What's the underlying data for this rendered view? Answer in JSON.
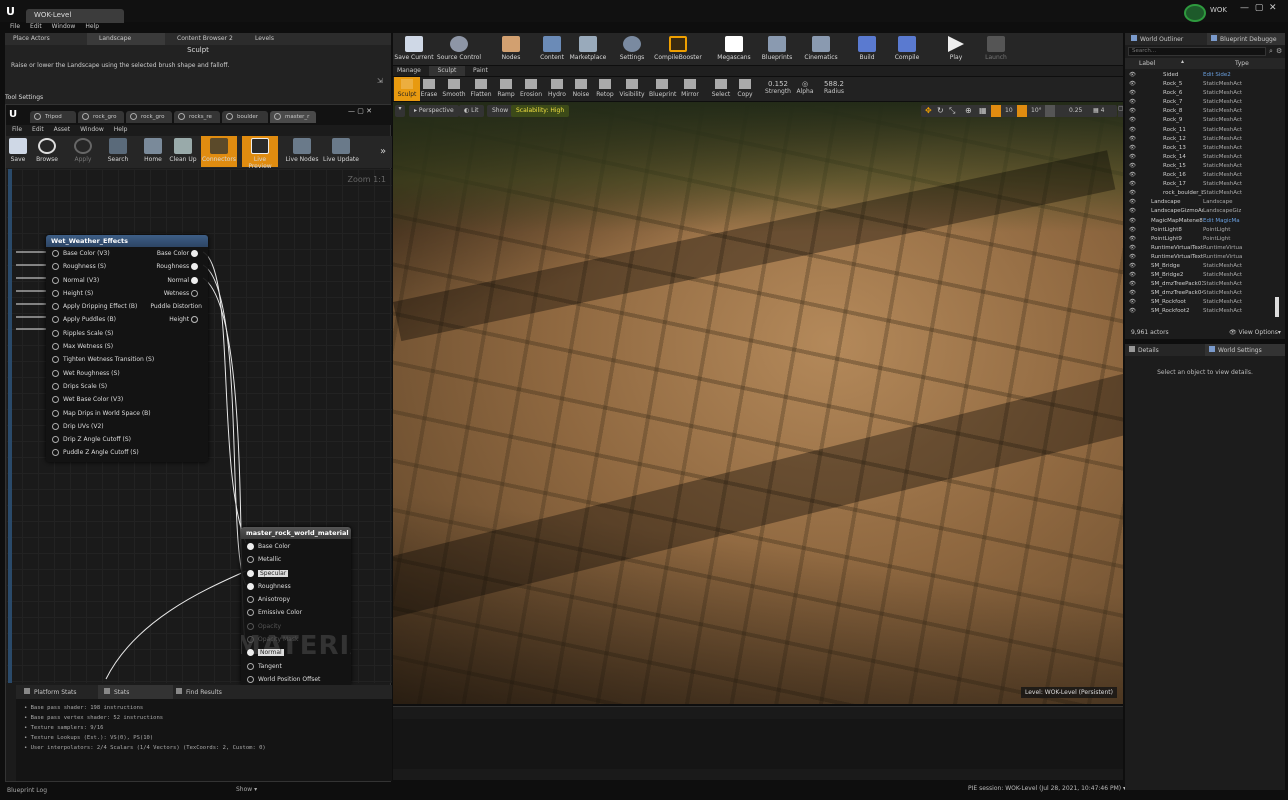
{
  "window": {
    "tab": "WOK-Level",
    "brand": "WOK",
    "menu": [
      "File",
      "Edit",
      "Window",
      "Help"
    ]
  },
  "modes": {
    "place": "Place Actors",
    "landscape": "Landscape",
    "content": "Content Browser 2",
    "levels": "Levels",
    "sculpt_title": "Sculpt",
    "sculpt_desc": "Raise or lower the Landscape using the selected brush shape and falloff.",
    "tool_settings": "Tool Settings"
  },
  "mat": {
    "tabs": [
      "Tripod",
      "rock_gro",
      "rock_gro",
      "rocks_re",
      "boulder",
      "master_r"
    ],
    "menu": [
      "File",
      "Edit",
      "Asset",
      "Window",
      "Help"
    ],
    "toolbar": [
      "Save",
      "Browse",
      "Apply",
      "Search",
      "Home",
      "Clean Up",
      "Connectors",
      "Live Preview",
      "Live Nodes",
      "Live Update"
    ],
    "zoom": "Zoom 1:1"
  },
  "node1": {
    "title": "Wet_Weather_Effects",
    "inputs": [
      "Base Color (V3)",
      "Roughness (S)",
      "Normal (V3)",
      "Height (S)",
      "Apply Dripping Effect (B)",
      "Apply Puddles (B)",
      "Ripples Scale (S)",
      "Max Wetness (S)",
      "Tighten Wetness Transition (S)",
      "Wet Roughness (S)",
      "Drips Scale (S)",
      "Wet Base Color (V3)",
      "Map Drips in World Space (B)",
      "Drip UVs (V2)",
      "Drip Z Angle Cutoff (S)",
      "Puddle Z Angle Cutoff (S)"
    ],
    "outputs": [
      "Base Color",
      "Roughness",
      "Normal",
      "Wetness",
      "Puddle Distortion",
      "Height"
    ]
  },
  "node2": {
    "title": "master_rock_world_material",
    "inputs": [
      "Base Color",
      "Metallic",
      "Specular",
      "Roughness",
      "Anisotropy",
      "Emissive Color",
      "Opacity",
      "Opacity Mask",
      "Normal",
      "Tangent",
      "World Position Offset"
    ],
    "watermark": "MATERIAL"
  },
  "stats": {
    "tabs": [
      "Platform Stats",
      "Stats",
      "Find Results"
    ],
    "lines": [
      "Base pass shader: 198 instructions",
      "Base pass vertex shader: 52 instructions",
      "Texture samplers: 9/16",
      "Texture Lookups (Est.): VS(0), PS(10)",
      "User interpolators: 2/4 Scalars (1/4 Vectors) (TexCoords: 2, Custom: 0)"
    ]
  },
  "bottom_left": {
    "log": "Blueprint Log",
    "show": "Show"
  },
  "main_toolbar": [
    "Save Current",
    "Source Control",
    "Nodes",
    "Content",
    "Marketplace",
    "Settings",
    "CompileBooster",
    "Megascans",
    "Blueprints",
    "Cinematics",
    "Build",
    "Compile",
    "Play",
    "Launch"
  ],
  "landscape_tabs": [
    "Manage",
    "Sculpt",
    "Paint"
  ],
  "sculpt_tools": [
    "Sculpt",
    "Erase",
    "Smooth",
    "Flatten",
    "Ramp",
    "Erosion",
    "Hydro",
    "Noise",
    "Retop",
    "Visibility",
    "Blueprint",
    "Mirror",
    "Select",
    "Copy"
  ],
  "strength": {
    "value": "0.152",
    "label": "Strength"
  },
  "alpha": {
    "label": "Alpha"
  },
  "radius": {
    "value": "588.2",
    "label": "Radius"
  },
  "viewport": {
    "perspective": "Perspective",
    "lit": "Lit",
    "show": "Show",
    "scalability": "Scalability: High",
    "snap1": "10",
    "snap2": "10°",
    "speed": "0.25",
    "cam": "4",
    "level": "Level: WOK-Level (Persistent)"
  },
  "outliner": {
    "tabs": [
      "World Outliner",
      "Blueprint Debugge"
    ],
    "search": "Search...",
    "col_label": "Label",
    "col_type": "Type",
    "rows": [
      [
        "Sided",
        "Edit Side2"
      ],
      [
        "Rock_5",
        "StaticMeshAct"
      ],
      [
        "Rock_6",
        "StaticMeshAct"
      ],
      [
        "Rock_7",
        "StaticMeshAct"
      ],
      [
        "Rock_8",
        "StaticMeshAct"
      ],
      [
        "Rock_9",
        "StaticMeshAct"
      ],
      [
        "Rock_11",
        "StaticMeshAct"
      ],
      [
        "Rock_12",
        "StaticMeshAct"
      ],
      [
        "Rock_13",
        "StaticMeshAct"
      ],
      [
        "Rock_14",
        "StaticMeshAct"
      ],
      [
        "Rock_15",
        "StaticMeshAct"
      ],
      [
        "Rock_16",
        "StaticMeshAct"
      ],
      [
        "Rock_17",
        "StaticMeshAct"
      ],
      [
        "rock_boulder_b3",
        "StaticMeshAct"
      ],
      [
        "Landscape",
        "Landscape"
      ],
      [
        "LandscapeGizmoActive",
        "LandscapeGiz"
      ],
      [
        "MagicMapMatene8P2",
        "Edit MagicMa"
      ],
      [
        "PointLight8",
        "PointLight"
      ],
      [
        "PointLight9",
        "PointLight"
      ],
      [
        "RuntimeVirtualTexture",
        "RuntimeVirtua"
      ],
      [
        "RuntimeVirtualTextureV",
        "RuntimeVirtua"
      ],
      [
        "SM_Bridge",
        "StaticMeshAct"
      ],
      [
        "SM_Bridge2",
        "StaticMeshAct"
      ],
      [
        "SM_dmzTreePack01_Bo",
        "StaticMeshAct"
      ],
      [
        "SM_dmzTreePack04_Bo",
        "StaticMeshAct"
      ],
      [
        "SM_Rockfoot",
        "StaticMeshAct"
      ],
      [
        "SM_Rockfoot2",
        "StaticMeshAct"
      ]
    ],
    "actors": "9,961 actors",
    "view_options": "View Options"
  },
  "details": {
    "tabs": [
      "Details",
      "World Settings"
    ],
    "empty": "Select an object to view details."
  },
  "status": {
    "pie": "PIE session: WOK-Level (Jul 28, 2021, 10:47:46 PM)"
  },
  "colors": {
    "accent": "#f0a000",
    "node_header": "#3d5e86",
    "bg": "#1a1a1a"
  }
}
